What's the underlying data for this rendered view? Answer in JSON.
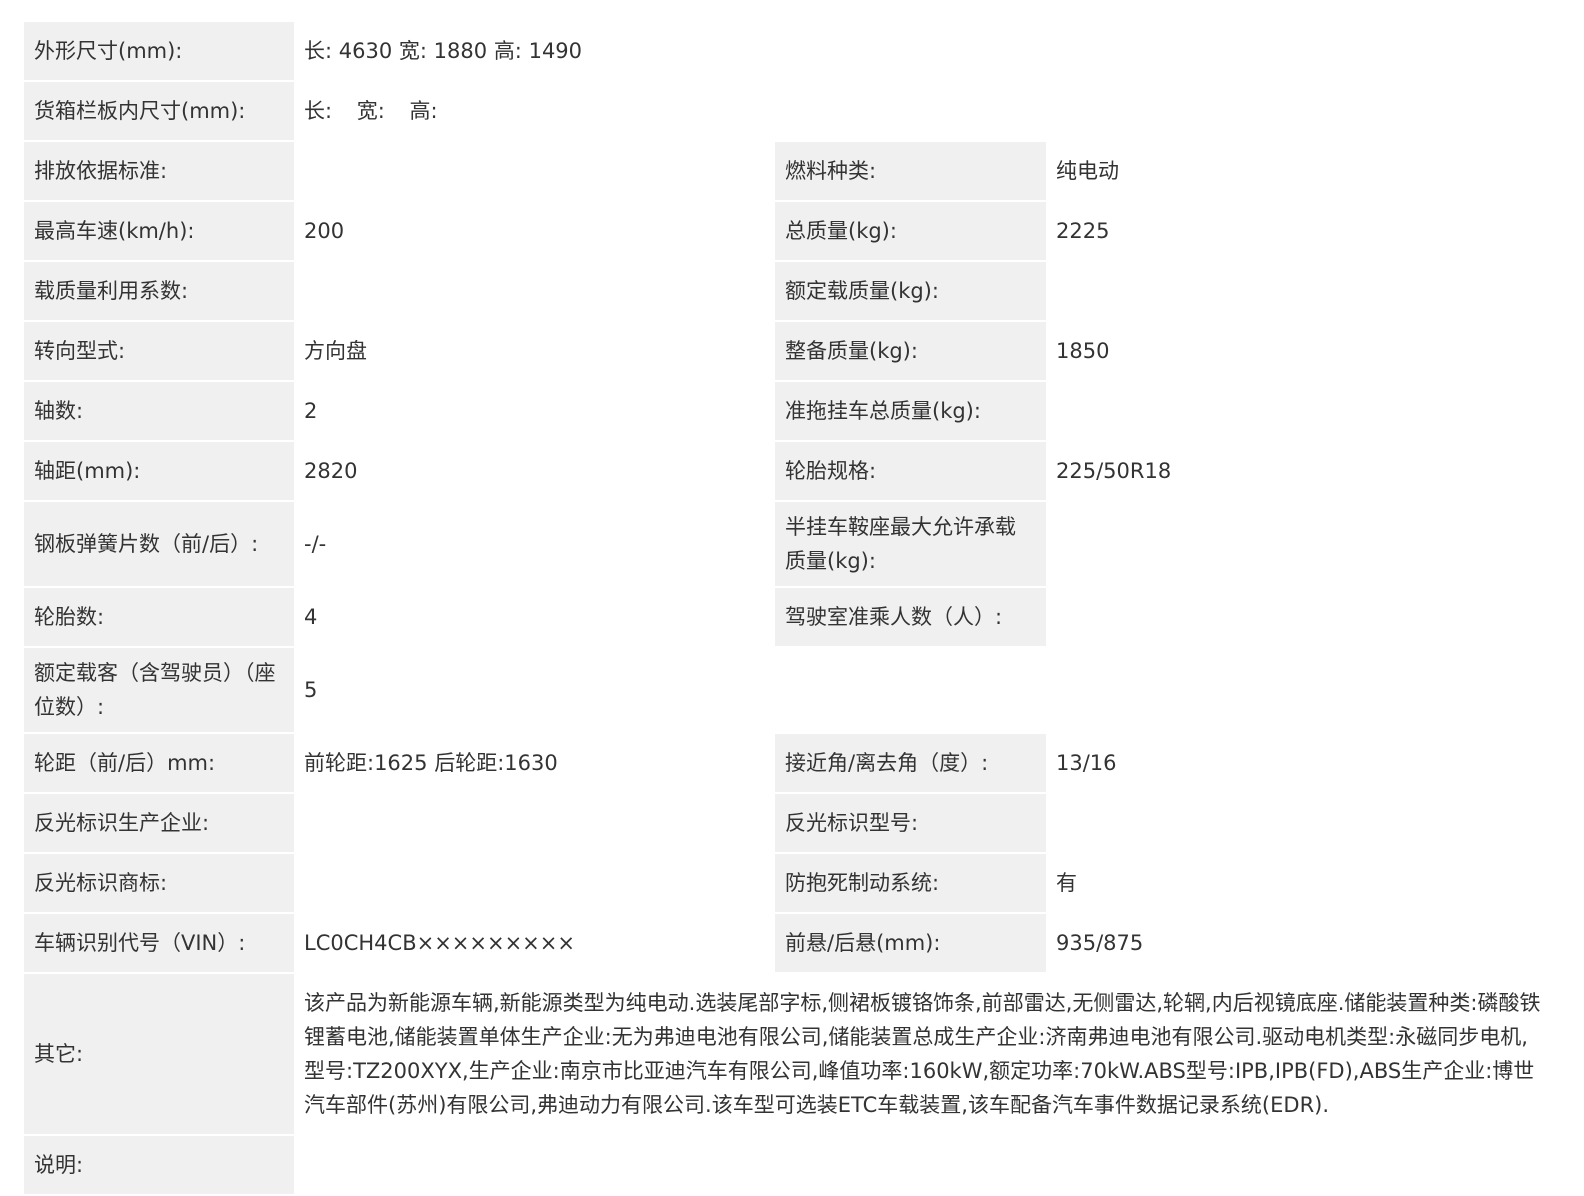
{
  "rows": {
    "dimensions": {
      "label": "外形尺寸(mm):",
      "len_label": "长:",
      "len": "4630",
      "wid_label": "宽:",
      "wid": "1880",
      "hei_label": "高:",
      "hei": "1490"
    },
    "cargo_box": {
      "label": "货箱栏板内尺寸(mm):",
      "len_label": "长:",
      "wid_label": "宽:",
      "hei_label": "高:"
    },
    "emission": {
      "label": "排放依据标准:",
      "value": "",
      "label2": "燃料种类:",
      "value2": "纯电动"
    },
    "speed": {
      "label": "最高车速(km/h):",
      "value": "200",
      "label2": "总质量(kg):",
      "value2": "2225"
    },
    "load_coef": {
      "label": "载质量利用系数:",
      "value": "",
      "label2": "额定载质量(kg):",
      "value2": ""
    },
    "steering": {
      "label": "转向型式:",
      "value": "方向盘",
      "label2": "整备质量(kg):",
      "value2": "1850"
    },
    "axles": {
      "label": "轴数:",
      "value": "2",
      "label2": "准拖挂车总质量(kg):",
      "value2": ""
    },
    "wheelbase": {
      "label": "轴距(mm):",
      "value": "2820",
      "label2": "轮胎规格:",
      "value2": "225/50R18"
    },
    "leaf_spring": {
      "label": "钢板弹簧片数（前/后）:",
      "value": "-/-",
      "label2": "半挂车鞍座最大允许承载质量(kg):",
      "value2": ""
    },
    "tires": {
      "label": "轮胎数:",
      "value": "4",
      "label2": "驾驶室准乘人数（人）:",
      "value2": ""
    },
    "seats": {
      "label": "额定载客（含驾驶员）（座位数）:",
      "value": "5"
    },
    "track": {
      "label": "轮距（前/后）mm:",
      "value": "前轮距:1625 后轮距:1630",
      "label2": "接近角/离去角（度）:",
      "value2": "13/16"
    },
    "reflect_maker": {
      "label": "反光标识生产企业:",
      "value": "",
      "label2": "反光标识型号:",
      "value2": ""
    },
    "reflect_brand": {
      "label": "反光标识商标:",
      "value": "",
      "label2": "防抱死制动系统:",
      "value2": "有"
    },
    "vin": {
      "label": "车辆识别代号（VIN）:",
      "value": "LC0CH4CB×××××××××",
      "label2": "前悬/后悬(mm):",
      "value2": "935/875"
    },
    "other": {
      "label": "其它:",
      "value": "该产品为新能源车辆,新能源类型为纯电动.选装尾部字标,侧裙板镀铬饰条,前部雷达,无侧雷达,轮辋,内后视镜底座.储能装置种类:磷酸铁锂蓄电池,储能装置单体生产企业:无为弗迪电池有限公司,储能装置总成生产企业:济南弗迪电池有限公司.驱动电机类型:永磁同步电机,型号:TZ200XYX,生产企业:南京市比亚迪汽车有限公司,峰值功率:160kW,额定功率:70kW.ABS型号:IPB,IPB(FD),ABS生产企业:博世汽车部件(苏州)有限公司,弗迪动力有限公司.该车型可选装ETC车载装置,该车配备汽车事件数据记录系统(EDR)."
    },
    "note": {
      "label": "说明:",
      "value": ""
    }
  }
}
